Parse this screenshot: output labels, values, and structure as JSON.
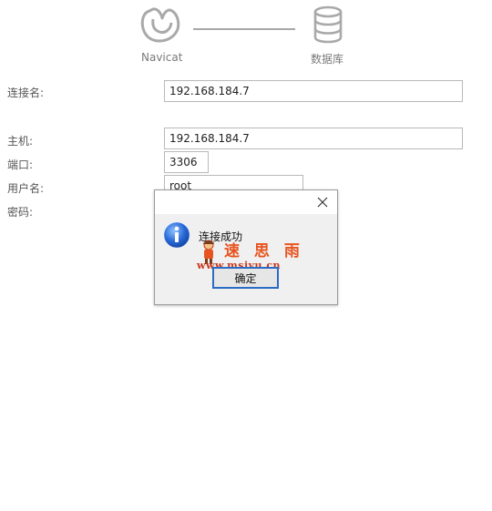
{
  "header": {
    "steps": [
      {
        "label": "Navicat",
        "icon": "navicat-logo-icon"
      },
      {
        "label": "数据库",
        "icon": "database-icon"
      }
    ]
  },
  "form": {
    "connection_name": {
      "label": "连接名:",
      "value": "192.168.184.7"
    },
    "host": {
      "label": "主机:",
      "value": "192.168.184.7"
    },
    "port": {
      "label": "端口:",
      "value": "3306"
    },
    "username": {
      "label": "用户名:",
      "value": "root"
    },
    "password": {
      "label": "密码:",
      "value": ""
    }
  },
  "dialog": {
    "icon": "info-icon",
    "message": "连接成功",
    "ok_label": "确定",
    "close_icon": "close-icon",
    "accent_color": "#2b6cc4"
  },
  "watermark": {
    "text": "速 思 雨",
    "url": "www.msiyu.cn"
  }
}
